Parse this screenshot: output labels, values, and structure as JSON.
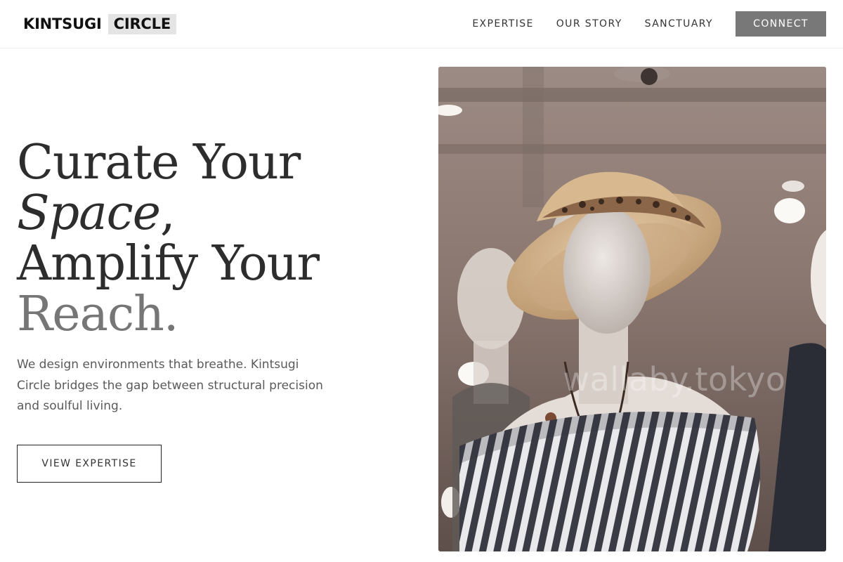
{
  "brand": {
    "word1": "KINTSUGI",
    "word2": "CIRCLE"
  },
  "nav": {
    "links": [
      "EXPERTISE",
      "OUR STORY",
      "SANCTUARY"
    ],
    "connect_label": "CONNECT"
  },
  "hero": {
    "headline_line1": "Curate Your",
    "headline_line2_italic": "Space",
    "headline_line2_punct": ",",
    "headline_line3": "Amplify Your",
    "headline_line4": "Reach.",
    "subtext": "We design environments that breathe. Kintsugi Circle bridges the gap between structural precision and soulful living.",
    "cta_label": "VIEW EXPERTISE",
    "image_watermark": "wallaby.tokyo"
  },
  "colors": {
    "connect_bg": "#787878",
    "muted_headline": "#767676",
    "logo_highlight": "#e4e4e4"
  }
}
